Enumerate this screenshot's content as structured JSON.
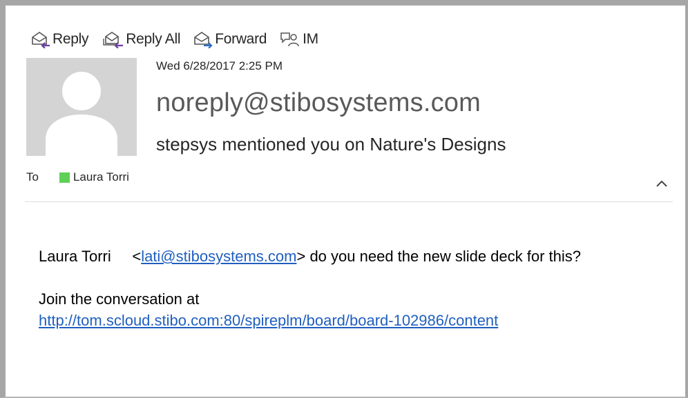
{
  "toolbar": {
    "reply_label": "Reply",
    "reply_all_label": "Reply All",
    "forward_label": "Forward",
    "im_label": "IM"
  },
  "message": {
    "date": "Wed 6/28/2017 2:25 PM",
    "sender": "noreply@stibosystems.com",
    "subject": "stepsys mentioned you on Nature's Designs",
    "to_label": "To",
    "recipient": "Laura  Torri",
    "presence_color": "#5fcf55"
  },
  "body": {
    "mention_name": "Laura  Torri",
    "mention_open": "<",
    "mention_email": "lati@stibosystems.com",
    "mention_close": ">",
    "mention_rest": " do you need the new slide deck for this?",
    "join_text": "Join the conversation at",
    "link": "http://tom.scloud.stibo.com:80/spireplm/board/board-102986/content"
  },
  "icons": [
    "reply-icon",
    "reply-all-icon",
    "forward-icon",
    "im-icon",
    "avatar-placeholder-icon",
    "chevron-up-icon"
  ]
}
